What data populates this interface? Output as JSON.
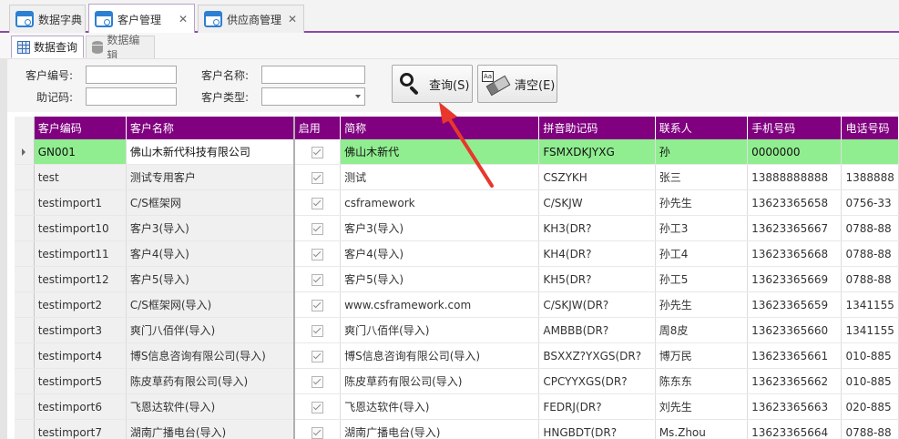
{
  "doc_tabs": [
    {
      "label": "数据字典",
      "closable": false
    },
    {
      "label": "客户管理",
      "closable": true
    },
    {
      "label": "供应商管理",
      "closable": true
    }
  ],
  "close_glyph": "✕",
  "inner_tabs": [
    "数据查询",
    "数据编辑"
  ],
  "query": {
    "customer_code_label": "客户编号:",
    "helper_code_label": "助记码:",
    "customer_name_label": "客户名称:",
    "customer_type_label": "客户类型:",
    "customer_code_value": "",
    "helper_code_value": "",
    "customer_name_value": "",
    "customer_type_value": "",
    "search_label": "查询(S)",
    "clear_label": "清空(E)",
    "clear_icon_text": "Aa"
  },
  "grid": {
    "columns": [
      "客户编码",
      "客户名称",
      "启用",
      "简称",
      "拼音助记码",
      "联系人",
      "手机号码",
      "电话号码"
    ],
    "rows": [
      {
        "code": "GN001",
        "name": "佛山木新代科技有限公司",
        "enabled": true,
        "short": "佛山木新代",
        "pinyin": "FSMXDKJYXG",
        "contact": "孙",
        "mobile": "0000000",
        "phone": ""
      },
      {
        "code": "test",
        "name": "测试专用客户",
        "enabled": true,
        "short": "测试",
        "pinyin": "CSZYKH",
        "contact": "张三",
        "mobile": "13888888888",
        "phone": "1388888"
      },
      {
        "code": "testimport1",
        "name": "C/S框架网",
        "enabled": true,
        "short": "csframework",
        "pinyin": "C/SKJW",
        "contact": "孙先生",
        "mobile": "13623365658",
        "phone": "0756-33"
      },
      {
        "code": "testimport10",
        "name": "客户3(导入)",
        "enabled": true,
        "short": "客户3(导入)",
        "pinyin": "KH3(DR?",
        "contact": "孙工3",
        "mobile": "13623365667",
        "phone": "0788-88"
      },
      {
        "code": "testimport11",
        "name": "客户4(导入)",
        "enabled": true,
        "short": "客户4(导入)",
        "pinyin": "KH4(DR?",
        "contact": "孙工4",
        "mobile": "13623365668",
        "phone": "0788-88"
      },
      {
        "code": "testimport12",
        "name": "客户5(导入)",
        "enabled": true,
        "short": "客户5(导入)",
        "pinyin": "KH5(DR?",
        "contact": "孙工5",
        "mobile": "13623365669",
        "phone": "0788-88"
      },
      {
        "code": "testimport2",
        "name": "C/S框架网(导入)",
        "enabled": true,
        "short": "www.csframework.com",
        "pinyin": "C/SKJW(DR?",
        "contact": "孙先生",
        "mobile": "13623365659",
        "phone": "1341155"
      },
      {
        "code": "testimport3",
        "name": "爽门八佰伴(导入)",
        "enabled": true,
        "short": "爽门八佰伴(导入)",
        "pinyin": "AMBBB(DR?",
        "contact": "周8皮",
        "mobile": "13623365660",
        "phone": "1341155"
      },
      {
        "code": "testimport4",
        "name": "博S信息咨询有限公司(导入)",
        "enabled": true,
        "short": "博S信息咨询有限公司(导入)",
        "pinyin": "BSXXZ?YXGS(DR?",
        "contact": "博万民",
        "mobile": "13623365661",
        "phone": "010-885"
      },
      {
        "code": "testimport5",
        "name": "陈皮草药有限公司(导入)",
        "enabled": true,
        "short": "陈皮草药有限公司(导入)",
        "pinyin": "CPCYYXGS(DR?",
        "contact": "陈东东",
        "mobile": "13623365662",
        "phone": "010-885"
      },
      {
        "code": "testimport6",
        "name": "飞恩达软件(导入)",
        "enabled": true,
        "short": "飞恩达软件(导入)",
        "pinyin": "FEDRJ(DR?",
        "contact": "刘先生",
        "mobile": "13623365663",
        "phone": "020-885"
      },
      {
        "code": "testimport7",
        "name": "湖南广播电台(导入)",
        "enabled": true,
        "short": "湖南广播电台(导入)",
        "pinyin": "HNGBDT(DR?",
        "contact": "Ms.Zhou",
        "mobile": "13623365664",
        "phone": "0788-88"
      }
    ]
  },
  "colors": {
    "header_bg": "#800080",
    "selected_row": "#90ee90",
    "accent_border": "#8b4aa0",
    "arrow": "#e8372c"
  }
}
